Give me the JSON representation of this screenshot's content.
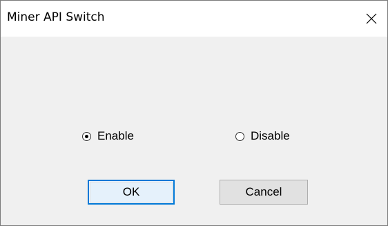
{
  "window": {
    "title": "Miner API Switch"
  },
  "radios": [
    {
      "label": "Enable",
      "checked": true
    },
    {
      "label": "Disable",
      "checked": false
    }
  ],
  "buttons": {
    "ok_label": "OK",
    "cancel_label": "Cancel"
  },
  "icons": {
    "close": "close-icon",
    "radio": "radio-button-icon"
  }
}
